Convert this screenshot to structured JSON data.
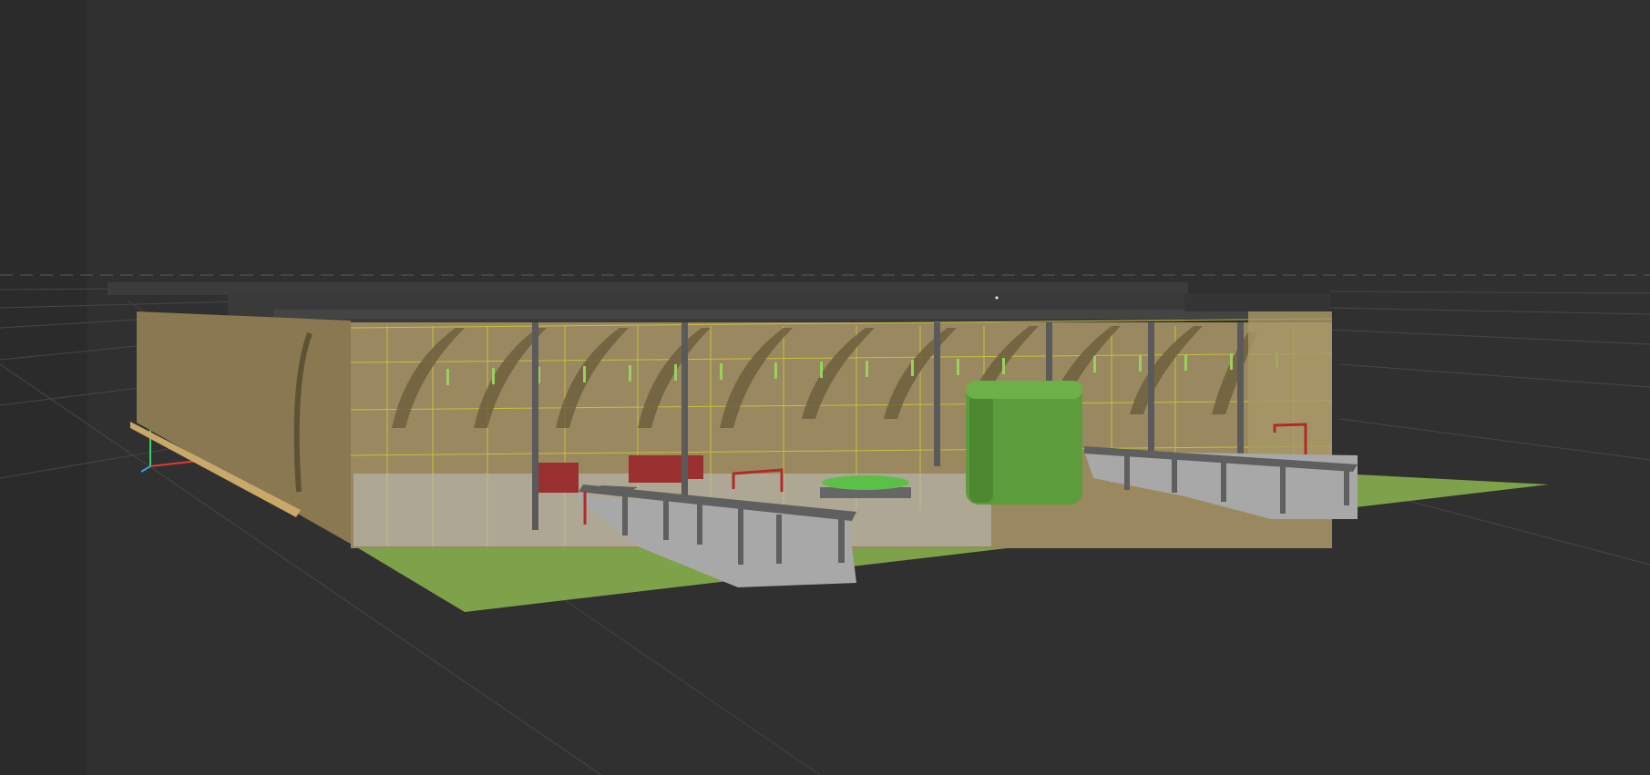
{
  "viewport": {
    "mode": "3d-perspective-viewport",
    "background_color": "#303030",
    "grid_line_color": "#4a4a4a",
    "horizon_dash_color": "#5c5c5c"
  },
  "axes_gizmo": {
    "x_color": "#e03a3a",
    "y_color": "#3aa0e0",
    "z_color": "#3ad06a"
  },
  "scene": {
    "model": "building",
    "colors": {
      "ground": "#7ea24a",
      "facade": "#8a7850",
      "facade_dark": "#5e5234",
      "roof": "#3a3a3a",
      "glass_grid": "#c8c03a",
      "column": "#5a5a5a",
      "pergola": "#5f5f5f",
      "walkway": "#a8a8a8",
      "door_red": "#9a3030",
      "volume_green": "#5d9c3c",
      "planter_green": "#5cc048"
    }
  }
}
